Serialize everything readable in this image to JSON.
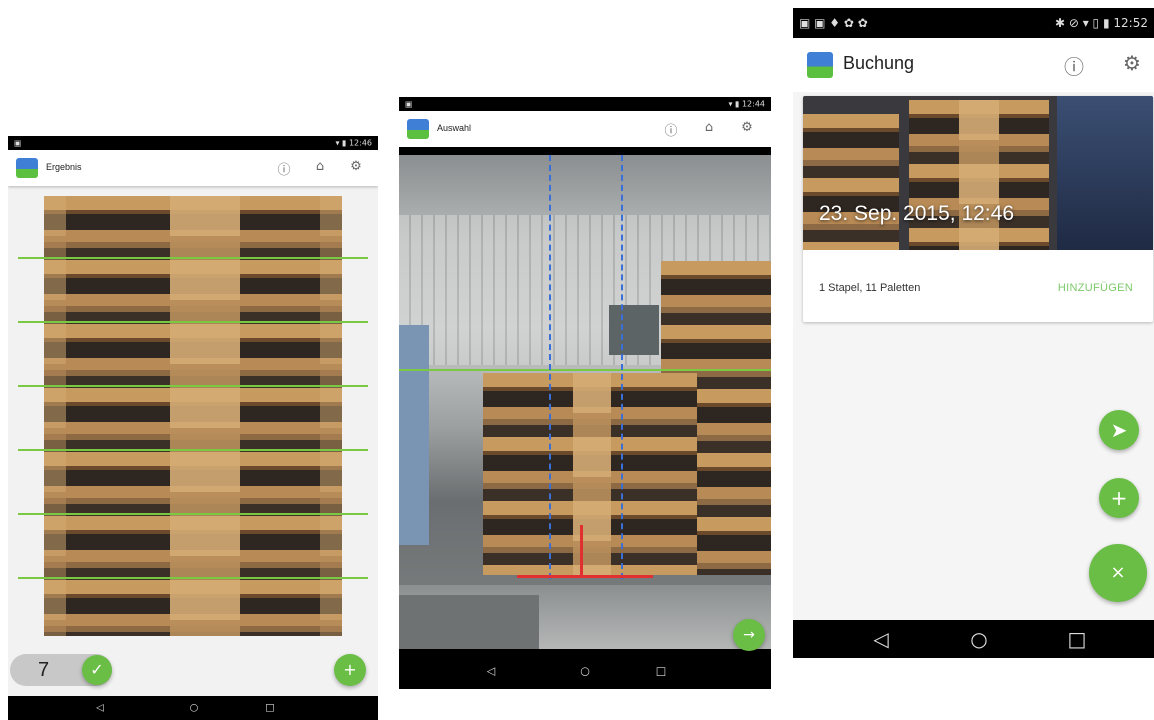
{
  "screen1": {
    "title": "Ergebnis",
    "counter_value": "7",
    "icons": {
      "info": "info-icon",
      "home": "home-icon",
      "settings": "gear-icon",
      "confirm": "check-icon",
      "add": "plus-icon"
    },
    "nav": {
      "back": "◁",
      "home": "○",
      "recent": "□"
    }
  },
  "screen2": {
    "title": "Auswahl",
    "icons": {
      "info": "info-icon",
      "home": "home-icon",
      "settings": "gear-icon",
      "next": "arrow-right-icon"
    },
    "nav": {
      "back": "◁",
      "home": "○",
      "recent": "□"
    }
  },
  "screen3": {
    "title": "Buchung",
    "status_time": "12:52",
    "card": {
      "photo_caption": "23. Sep. 2015, 12:46",
      "summary": "1 Stapel, 11 Paletten",
      "action_label": "HINZUFÜGEN"
    },
    "icons": {
      "info": "info-icon",
      "settings": "gear-icon",
      "send": "send-icon",
      "add": "plus-icon",
      "close": "close-icon"
    },
    "nav": {
      "back": "◁",
      "home": "○",
      "recent": "□"
    }
  },
  "colors": {
    "accent_green": "#6abd45",
    "guide_green": "#7ac943",
    "guide_blue": "#3a6fd8",
    "guide_red": "#e03030",
    "action_text": "#7cc96a"
  }
}
